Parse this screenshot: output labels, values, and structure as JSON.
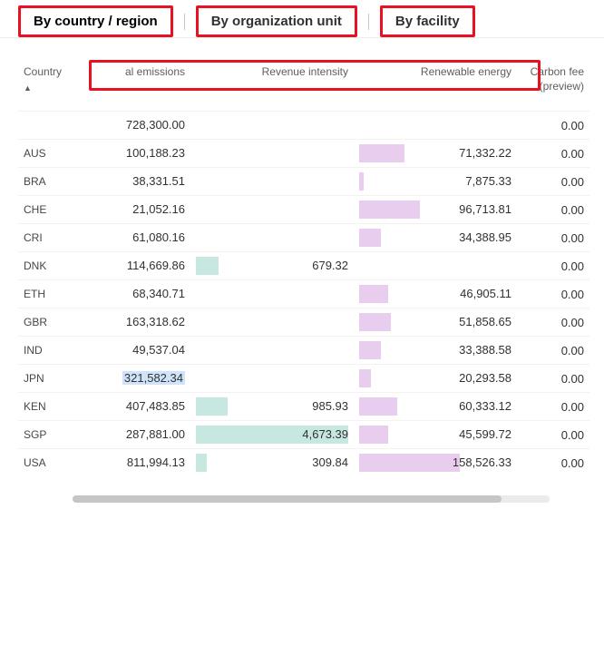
{
  "tabs": {
    "t0": "By country / region",
    "t1": "By organization unit",
    "t2": "By facility"
  },
  "columns": {
    "country": "Country",
    "emissions": "al emissions",
    "revenue": "Revenue intensity",
    "renewable": "Renewable energy",
    "fee": "Carbon fee (preview)"
  },
  "rows": [
    {
      "country": "",
      "emissions": "728,300.00",
      "revenue": "",
      "renewable": "",
      "fee": "0.00",
      "emBar": 0,
      "revBar": 0,
      "renBar": 0
    },
    {
      "country": "AUS",
      "emissions": "100,188.23",
      "revenue": "",
      "renewable": "71,332.22",
      "fee": "0.00",
      "emBar": 0,
      "revBar": 0,
      "renBar": 30
    },
    {
      "country": "BRA",
      "emissions": "38,331.51",
      "revenue": "",
      "renewable": "7,875.33",
      "fee": "0.00",
      "emBar": 0,
      "revBar": 0,
      "renBar": 3
    },
    {
      "country": "CHE",
      "emissions": "21,052.16",
      "revenue": "",
      "renewable": "96,713.81",
      "fee": "0.00",
      "emBar": 0,
      "revBar": 0,
      "renBar": 40
    },
    {
      "country": "CRI",
      "emissions": "61,080.16",
      "revenue": "",
      "renewable": "34,388.95",
      "fee": "0.00",
      "emBar": 0,
      "revBar": 0,
      "renBar": 14
    },
    {
      "country": "DNK",
      "emissions": "114,669.86",
      "revenue": "679.32",
      "renewable": "",
      "fee": "0.00",
      "emBar": 0,
      "revBar": 15,
      "renBar": 0
    },
    {
      "country": "ETH",
      "emissions": "68,340.71",
      "revenue": "",
      "renewable": "46,905.11",
      "fee": "0.00",
      "emBar": 0,
      "revBar": 0,
      "renBar": 19
    },
    {
      "country": "GBR",
      "emissions": "163,318.62",
      "revenue": "",
      "renewable": "51,858.65",
      "fee": "0.00",
      "emBar": 0,
      "revBar": 0,
      "renBar": 21
    },
    {
      "country": "IND",
      "emissions": "49,537.04",
      "revenue": "",
      "renewable": "33,388.58",
      "fee": "0.00",
      "emBar": 0,
      "revBar": 0,
      "renBar": 14
    },
    {
      "country": "JPN",
      "emissions": "321,582.34",
      "revenue": "",
      "renewable": "20,293.58",
      "fee": "0.00",
      "emBar": 0,
      "revBar": 0,
      "renBar": 8,
      "emSel": true
    },
    {
      "country": "KEN",
      "emissions": "407,483.85",
      "revenue": "985.93",
      "renewable": "60,333.12",
      "fee": "0.00",
      "emBar": 0,
      "revBar": 21,
      "renBar": 25
    },
    {
      "country": "SGP",
      "emissions": "287,881.00",
      "revenue": "4,673.39",
      "renewable": "45,599.72",
      "fee": "0.00",
      "emBar": 0,
      "revBar": 100,
      "renBar": 19
    },
    {
      "country": "USA",
      "emissions": "811,994.13",
      "revenue": "309.84",
      "renewable": "158,526.33",
      "fee": "0.00",
      "emBar": 0,
      "revBar": 7,
      "renBar": 66
    }
  ]
}
